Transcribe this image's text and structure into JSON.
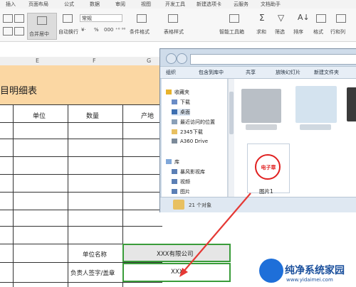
{
  "ribbon": {
    "menu": [
      "插入",
      "页面布局",
      "公式",
      "数据",
      "审阅",
      "视图",
      "开发工具",
      "新建选项卡",
      "云服务",
      "文档助手"
    ],
    "number_format": "常规",
    "merge_label": "合并居中",
    "wrap_label": "自动换行",
    "percent_symbol": "%",
    "buttons": [
      "条件格式",
      "表格样式",
      "智能工具箱",
      "求和",
      "筛选",
      "排序",
      "格式",
      "行和列"
    ]
  },
  "sheet": {
    "column_letters": [
      "E",
      "F",
      "G"
    ],
    "title": "目明细表",
    "headers": [
      "单位",
      "数量",
      "产地"
    ],
    "unit_name_label": "单位名称",
    "company_value": "XXX有限公司",
    "signer_label": "负责人签字/盖章",
    "signer_value": "XXX"
  },
  "explorer": {
    "toolbar": [
      "组织",
      "包含到库中",
      "共享",
      "放映幻灯片",
      "新建文件夹"
    ],
    "favorites_heading": "收藏夹",
    "favorites": [
      "下载",
      "桌面",
      "最近访问的位置",
      "2345下载",
      "A360 Drive"
    ],
    "libraries_heading": "库",
    "libraries": [
      "暴风影视库",
      "视频",
      "图片"
    ],
    "selected_file": "图片1",
    "stamp_text": "电子章",
    "status": "21 个对象"
  },
  "watermark": {
    "text": "纯净系统家园",
    "url": "www.yidaimei.com"
  },
  "colors": {
    "title_band": "#fbd7a3",
    "selection_border": "#3a9c3a",
    "stamp_red": "#e02020",
    "arrow_red": "#e53935"
  }
}
